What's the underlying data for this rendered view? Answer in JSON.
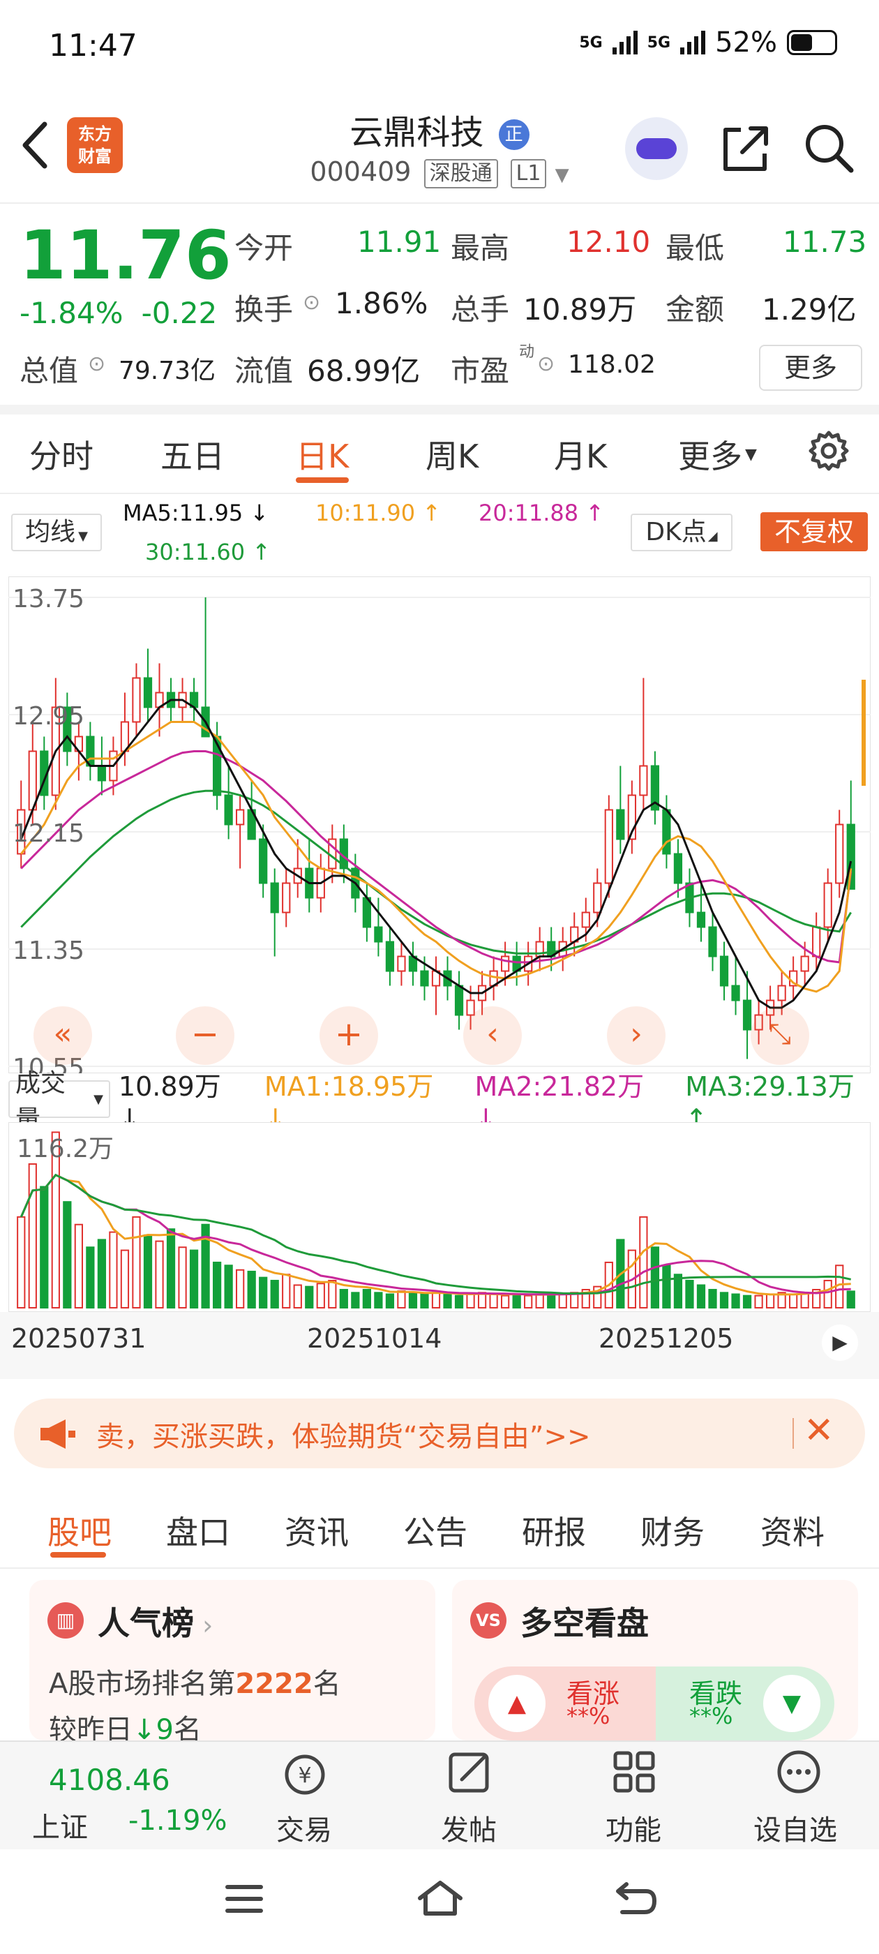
{
  "status": {
    "time": "11:47",
    "net1": "5G",
    "net2": "5G",
    "battery": "52%"
  },
  "header": {
    "logo_line1": "东方",
    "logo_line2": "财富",
    "title": "云鼎科技",
    "badge": "正",
    "code": "000409",
    "tag1": "深股通",
    "tag2": "L1"
  },
  "quote": {
    "price": "11.76",
    "pct": "-1.84%",
    "change": "-0.22",
    "open_label": "今开",
    "open": "11.91",
    "high_label": "最高",
    "high": "12.10",
    "low_label": "最低",
    "low": "11.73",
    "turnover_label": "换手",
    "turnover": "1.86%",
    "volume_label": "总手",
    "volume": "10.89万",
    "amount_label": "金额",
    "amount": "1.29亿",
    "mktcap_label": "总值",
    "mktcap": "79.73亿",
    "float_label": "流值",
    "float": "68.99亿",
    "pe_label": "市盈",
    "pe_sup": "动",
    "pe": "118.02",
    "more": "更多"
  },
  "period_tabs": [
    "分时",
    "五日",
    "日K",
    "周K",
    "月K",
    "更多"
  ],
  "ma_legend": {
    "selector": "均线",
    "ma5": "MA5:11.95 ↓",
    "ma10": "10:11.90 ↑",
    "ma20": "20:11.88 ↑",
    "ma30": "30:11.60 ↑",
    "dk": "DK点",
    "fuquan": "不复权"
  },
  "colors": {
    "up": "#e0312e",
    "down": "#12a03a",
    "accent": "#e8602a",
    "ma5": "#111111",
    "ma10": "#f0a020",
    "ma20": "#c8289a",
    "ma30": "#1f9b3a"
  },
  "chart_data": [
    {
      "type": "candlestick",
      "y_ticks": [
        "13.75",
        "12.95",
        "12.15",
        "11.35",
        "10.55"
      ],
      "ylim": [
        10.55,
        13.75
      ],
      "x_labels": [
        "20250731",
        "20251014",
        "20251205"
      ],
      "ohlc": [
        [
          12.0,
          12.5,
          11.9,
          12.3
        ],
        [
          12.3,
          12.9,
          12.2,
          12.7
        ],
        [
          12.7,
          12.8,
          12.3,
          12.4
        ],
        [
          12.4,
          13.2,
          12.3,
          13.0
        ],
        [
          13.0,
          13.1,
          12.6,
          12.7
        ],
        [
          12.7,
          12.9,
          12.5,
          12.8
        ],
        [
          12.8,
          12.9,
          12.5,
          12.6
        ],
        [
          12.6,
          12.8,
          12.4,
          12.5
        ],
        [
          12.5,
          12.8,
          12.4,
          12.7
        ],
        [
          12.7,
          13.1,
          12.6,
          12.9
        ],
        [
          12.9,
          13.3,
          12.8,
          13.2
        ],
        [
          13.2,
          13.4,
          12.9,
          13.0
        ],
        [
          13.0,
          13.3,
          12.8,
          13.1
        ],
        [
          13.1,
          13.2,
          12.9,
          13.0
        ],
        [
          13.0,
          13.2,
          12.9,
          13.1
        ],
        [
          13.1,
          13.2,
          12.9,
          13.0
        ],
        [
          13.0,
          13.75,
          12.8,
          12.8
        ],
        [
          12.8,
          12.9,
          12.3,
          12.4
        ],
        [
          12.4,
          12.6,
          12.1,
          12.2
        ],
        [
          12.2,
          12.4,
          11.9,
          12.3
        ],
        [
          12.3,
          12.5,
          12.1,
          12.1
        ],
        [
          12.1,
          12.2,
          11.7,
          11.8
        ],
        [
          11.8,
          11.9,
          11.3,
          11.6
        ],
        [
          11.6,
          11.9,
          11.5,
          11.8
        ],
        [
          11.8,
          12.1,
          11.7,
          11.9
        ],
        [
          11.9,
          12.1,
          11.6,
          11.7
        ],
        [
          11.7,
          12.0,
          11.6,
          11.9
        ],
        [
          11.9,
          12.2,
          11.8,
          12.1
        ],
        [
          12.1,
          12.2,
          11.8,
          11.9
        ],
        [
          11.9,
          12.0,
          11.6,
          11.7
        ],
        [
          11.7,
          11.8,
          11.4,
          11.5
        ],
        [
          11.5,
          11.7,
          11.3,
          11.4
        ],
        [
          11.4,
          11.5,
          11.1,
          11.2
        ],
        [
          11.2,
          11.4,
          11.1,
          11.3
        ],
        [
          11.3,
          11.4,
          11.1,
          11.2
        ],
        [
          11.2,
          11.3,
          11.0,
          11.1
        ],
        [
          11.1,
          11.3,
          10.9,
          11.2
        ],
        [
          11.2,
          11.3,
          11.0,
          11.1
        ],
        [
          11.1,
          11.2,
          10.8,
          10.9
        ],
        [
          10.9,
          11.1,
          10.8,
          11.0
        ],
        [
          11.0,
          11.2,
          10.9,
          11.1
        ],
        [
          11.1,
          11.3,
          11.0,
          11.2
        ],
        [
          11.2,
          11.4,
          11.1,
          11.3
        ],
        [
          11.3,
          11.4,
          11.1,
          11.2
        ],
        [
          11.2,
          11.4,
          11.1,
          11.3
        ],
        [
          11.3,
          11.5,
          11.2,
          11.4
        ],
        [
          11.4,
          11.5,
          11.2,
          11.3
        ],
        [
          11.3,
          11.5,
          11.2,
          11.4
        ],
        [
          11.4,
          11.6,
          11.3,
          11.5
        ],
        [
          11.5,
          11.7,
          11.4,
          11.6
        ],
        [
          11.6,
          11.9,
          11.5,
          11.8
        ],
        [
          11.8,
          12.4,
          11.7,
          12.3
        ],
        [
          12.3,
          12.6,
          12.0,
          12.1
        ],
        [
          12.1,
          12.5,
          12.0,
          12.4
        ],
        [
          12.4,
          13.2,
          12.3,
          12.6
        ],
        [
          12.6,
          12.7,
          12.2,
          12.3
        ],
        [
          12.3,
          12.4,
          11.9,
          12.0
        ],
        [
          12.0,
          12.1,
          11.7,
          11.8
        ],
        [
          11.8,
          11.9,
          11.5,
          11.6
        ],
        [
          11.6,
          11.8,
          11.4,
          11.5
        ],
        [
          11.5,
          11.6,
          11.2,
          11.3
        ],
        [
          11.3,
          11.4,
          11.0,
          11.1
        ],
        [
          11.1,
          11.3,
          10.9,
          11.0
        ],
        [
          11.0,
          11.2,
          10.6,
          10.8
        ],
        [
          10.8,
          11.0,
          10.7,
          10.9
        ],
        [
          10.9,
          11.1,
          10.8,
          11.0
        ],
        [
          11.0,
          11.2,
          10.9,
          11.1
        ],
        [
          11.1,
          11.3,
          11.0,
          11.2
        ],
        [
          11.2,
          11.4,
          11.1,
          11.3
        ],
        [
          11.3,
          11.6,
          11.2,
          11.5
        ],
        [
          11.5,
          11.9,
          11.4,
          11.8
        ],
        [
          11.8,
          12.3,
          11.7,
          12.2
        ],
        [
          12.2,
          12.5,
          11.9,
          11.76
        ]
      ],
      "ma5": [
        12.1,
        12.3,
        12.5,
        12.7,
        12.8,
        12.7,
        12.6,
        12.6,
        12.6,
        12.7,
        12.8,
        12.9,
        13.0,
        13.05,
        13.05,
        13.0,
        12.9,
        12.75,
        12.6,
        12.45,
        12.3,
        12.15,
        12.0,
        11.9,
        11.85,
        11.8,
        11.8,
        11.85,
        11.85,
        11.8,
        11.7,
        11.6,
        11.5,
        11.4,
        11.3,
        11.25,
        11.2,
        11.15,
        11.1,
        11.05,
        11.05,
        11.1,
        11.15,
        11.2,
        11.25,
        11.3,
        11.3,
        11.35,
        11.4,
        11.45,
        11.55,
        11.75,
        11.95,
        12.15,
        12.3,
        12.35,
        12.3,
        12.2,
        12.0,
        11.8,
        11.6,
        11.45,
        11.3,
        11.15,
        11.0,
        10.95,
        10.95,
        11.0,
        11.1,
        11.2,
        11.4,
        11.6,
        11.95
      ],
      "ma10": [
        12.0,
        12.1,
        12.2,
        12.35,
        12.5,
        12.6,
        12.65,
        12.65,
        12.65,
        12.7,
        12.75,
        12.8,
        12.85,
        12.9,
        12.9,
        12.9,
        12.85,
        12.8,
        12.7,
        12.6,
        12.5,
        12.4,
        12.25,
        12.15,
        12.05,
        11.95,
        11.9,
        11.88,
        11.86,
        11.84,
        11.8,
        11.75,
        11.68,
        11.6,
        11.52,
        11.45,
        11.4,
        11.33,
        11.27,
        11.22,
        11.18,
        11.16,
        11.15,
        11.16,
        11.18,
        11.21,
        11.24,
        11.28,
        11.32,
        11.37,
        11.42,
        11.5,
        11.6,
        11.72,
        11.85,
        11.98,
        12.08,
        12.12,
        12.1,
        12.05,
        11.95,
        11.82,
        11.68,
        11.55,
        11.42,
        11.3,
        11.2,
        11.12,
        11.08,
        11.06,
        11.1,
        11.2,
        11.9
      ],
      "ma20": [
        11.9,
        11.98,
        12.06,
        12.14,
        12.22,
        12.3,
        12.36,
        12.42,
        12.46,
        12.5,
        12.54,
        12.58,
        12.62,
        12.66,
        12.69,
        12.7,
        12.7,
        12.68,
        12.64,
        12.6,
        12.55,
        12.5,
        12.43,
        12.36,
        12.28,
        12.2,
        12.12,
        12.05,
        11.98,
        11.92,
        11.86,
        11.8,
        11.74,
        11.68,
        11.62,
        11.56,
        11.5,
        11.45,
        11.4,
        11.36,
        11.32,
        11.29,
        11.27,
        11.26,
        11.26,
        11.27,
        11.28,
        11.3,
        11.32,
        11.35,
        11.38,
        11.42,
        11.47,
        11.52,
        11.58,
        11.64,
        11.7,
        11.75,
        11.79,
        11.81,
        11.82,
        11.8,
        11.76,
        11.7,
        11.63,
        11.55,
        11.48,
        11.41,
        11.35,
        11.3,
        11.27,
        11.26,
        11.88
      ],
      "ma30": [
        11.5,
        11.58,
        11.66,
        11.74,
        11.82,
        11.9,
        11.98,
        12.05,
        12.12,
        12.18,
        12.24,
        12.29,
        12.33,
        12.37,
        12.4,
        12.42,
        12.43,
        12.43,
        12.42,
        12.4,
        12.37,
        12.33,
        12.28,
        12.22,
        12.16,
        12.1,
        12.04,
        11.98,
        11.92,
        11.86,
        11.8,
        11.74,
        11.68,
        11.62,
        11.57,
        11.52,
        11.48,
        11.44,
        11.41,
        11.38,
        11.36,
        11.34,
        11.33,
        11.32,
        11.32,
        11.32,
        11.33,
        11.34,
        11.36,
        11.38,
        11.41,
        11.44,
        11.48,
        11.52,
        11.56,
        11.6,
        11.64,
        11.67,
        11.7,
        11.72,
        11.73,
        11.73,
        11.72,
        11.7,
        11.67,
        11.63,
        11.59,
        11.55,
        11.52,
        11.5,
        11.48,
        11.47,
        11.6
      ]
    },
    {
      "type": "bar",
      "label": "成交量",
      "current": "10.89万 ↓",
      "ma1": "MA1:18.95万 ↓",
      "ma2": "MA2:21.82万 ↓",
      "ma3": "MA3:29.13万 ↑",
      "ymax_label": "116.2万",
      "ymax": 116.2,
      "values": [
        60,
        95,
        80,
        116,
        70,
        55,
        40,
        45,
        50,
        38,
        60,
        48,
        44,
        52,
        40,
        38,
        55,
        30,
        28,
        25,
        24,
        20,
        18,
        22,
        15,
        14,
        16,
        18,
        12,
        10,
        12,
        10,
        9,
        11,
        10,
        9,
        10,
        9,
        8,
        9,
        10,
        9,
        8,
        9,
        8,
        9,
        10,
        9,
        10,
        12,
        14,
        30,
        45,
        38,
        60,
        40,
        28,
        22,
        18,
        15,
        12,
        10,
        9,
        8,
        8,
        9,
        10,
        9,
        10,
        12,
        18,
        28,
        10.89
      ]
    }
  ],
  "banner": {
    "text": "卖，买涨买跌，体验期货“交易自由”>>"
  },
  "info_tabs": [
    "股吧",
    "盘口",
    "资讯",
    "公告",
    "研报",
    "财务",
    "资料"
  ],
  "popularity": {
    "title": "人气榜",
    "rank_prefix": "A股市场排名第",
    "rank": "2222",
    "rank_suffix": "名",
    "change_prefix": "较昨日",
    "change": "9",
    "change_suffix": "名"
  },
  "bullbear": {
    "title": "多空看盘",
    "up_label": "看涨",
    "up_val": "**%",
    "down_label": "看跌",
    "down_val": "**%"
  },
  "bottom": {
    "index_value": "4108.46",
    "index_name": "上证",
    "index_pct": "-1.19%",
    "trade": "交易",
    "post": "发帖",
    "func": "功能",
    "watch": "设自选"
  }
}
